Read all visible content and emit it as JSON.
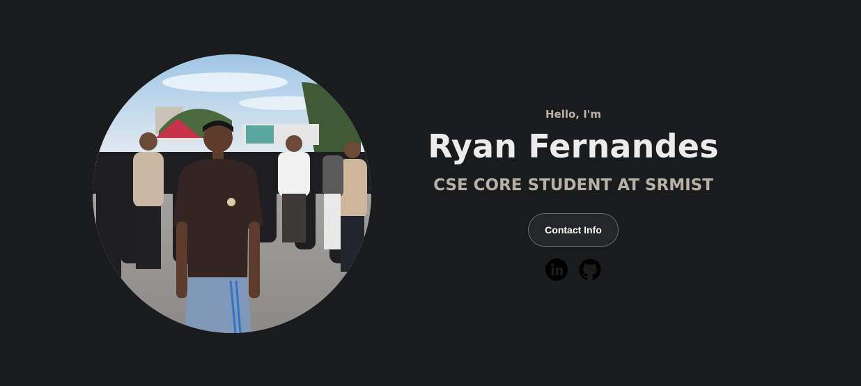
{
  "hero": {
    "greeting": "Hello, I'm",
    "name": "Ryan Fernandes",
    "title": "CSE CORE STUDENT AT SRMIST",
    "contact_button_label": "Contact Info"
  },
  "socials": [
    {
      "icon": "linkedin-icon",
      "label": "LinkedIn"
    },
    {
      "icon": "github-icon",
      "label": "GitHub"
    }
  ],
  "colors": {
    "background": "#1a1b1d",
    "greeting": "#b9b3a7",
    "name": "#ececec",
    "title": "#b7b2a8",
    "button_bg": "#242628",
    "button_border": "#6b6b6b",
    "icon": "#000000"
  }
}
